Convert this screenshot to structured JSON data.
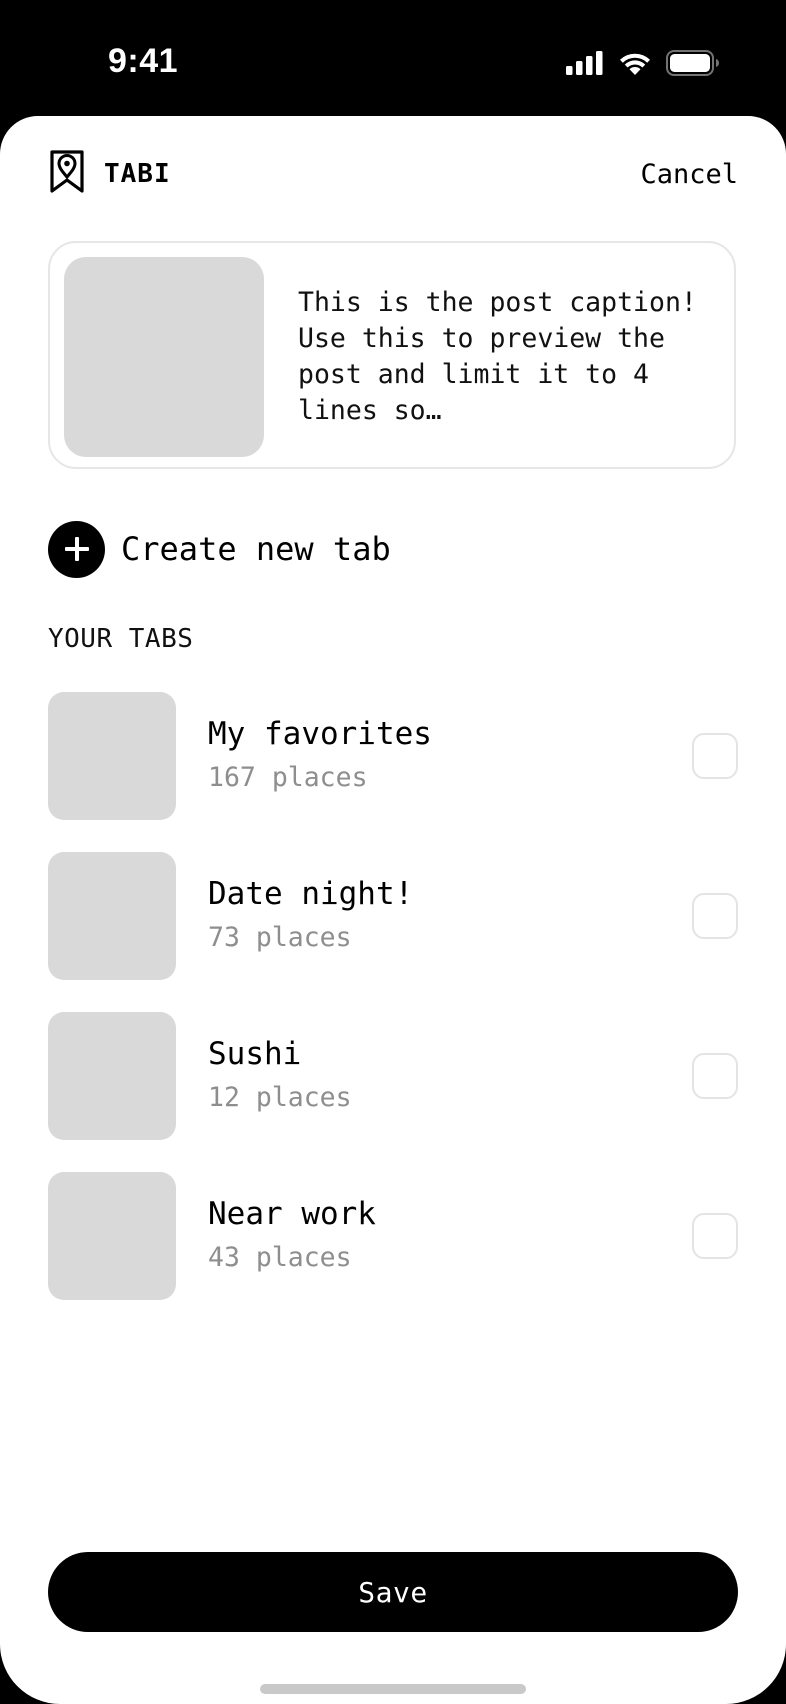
{
  "status_bar": {
    "time": "9:41",
    "icons": [
      "cellular-signal-icon",
      "wifi-icon",
      "battery-icon"
    ]
  },
  "header": {
    "app_name": "TABI",
    "logo_icon": "bookmark-pin-icon",
    "cancel_label": "Cancel"
  },
  "post": {
    "caption": "This is the post caption! Use this to preview the post and limit it to 4 lines so…"
  },
  "create_tab": {
    "label": "Create new tab",
    "icon": "plus-icon"
  },
  "tabs_section": {
    "title": "YOUR TABS",
    "items": [
      {
        "name": "My favorites",
        "count": "167 places",
        "checked": false
      },
      {
        "name": "Date night!",
        "count": "73 places",
        "checked": false
      },
      {
        "name": "Sushi",
        "count": "12 places",
        "checked": false
      },
      {
        "name": "Near work",
        "count": "43 places",
        "checked": false
      }
    ]
  },
  "footer": {
    "save_label": "Save"
  },
  "colors": {
    "primary": "#000000",
    "placeholder": "#d9d9d9",
    "muted_text": "#8e8e8e",
    "border": "#e6e6e6",
    "background": "#ffffff"
  }
}
